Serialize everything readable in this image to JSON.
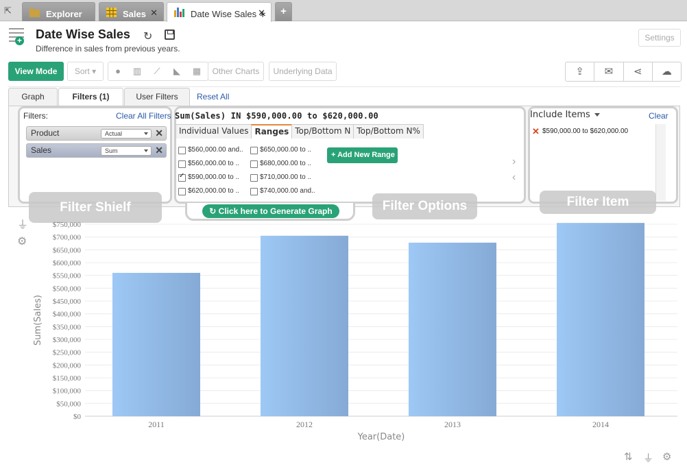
{
  "tabs": {
    "explorer": "Explorer",
    "sales": "Sales",
    "active": "Date Wise Sales ∗",
    "close": "✕",
    "new": "+"
  },
  "header": {
    "title": "Date Wise Sales",
    "subtitle": "Difference in sales from previous years.",
    "settings": "Settings"
  },
  "toolbar": {
    "view_mode": "View Mode",
    "sort": "Sort ▾",
    "other_charts": "Other Charts",
    "underlying_data": "Underlying Data",
    "chart_icons": [
      "pie-chart-icon",
      "bar-chart-icon",
      "line-chart-icon",
      "area-chart-icon",
      "table-icon"
    ],
    "actions": [
      "export-icon",
      "email-icon",
      "share-icon",
      "publish-icon"
    ]
  },
  "filter_tabs": {
    "graph": "Graph",
    "filters": "Filters  (1)",
    "user_filters": "User Filters",
    "reset_all": "Reset All"
  },
  "shelf": {
    "label": "Filters:",
    "clear_all": "Clear All Filters",
    "pills": [
      {
        "name": "Product",
        "option": "Actual"
      },
      {
        "name": "Sales",
        "option": "Sum"
      }
    ]
  },
  "options": {
    "title": "Sum(Sales) IN $590,000.00 to $620,000.00",
    "tabs": [
      "Individual Values",
      "Ranges",
      "Top/Bottom N",
      "Top/Bottom N%"
    ],
    "active_tab": "Ranges",
    "ranges_col1": [
      "$560,000.00 and..",
      "$560,000.00 to ..",
      "$590,000.00 to ..",
      "$620,000.00 to .."
    ],
    "ranges_col2": [
      "$650,000.00 to ..",
      "$680,000.00 to ..",
      "$710,000.00 to ..",
      "$740,000.00 and.."
    ],
    "checked": "$590,000.00 to ..",
    "add_range": "Add New Range"
  },
  "include": {
    "title": "Include Items",
    "clear": "Clear",
    "items": [
      "$590,000.00 to $620,000.00"
    ]
  },
  "overlays": {
    "shelf": "Filter Shielf",
    "options": "Filter Options",
    "item": "Filter Item"
  },
  "generate": "Click here to Generate Graph",
  "colors": {
    "accent": "#2aa277",
    "link": "#2a5aa8",
    "bar_light": "#9ec8f5",
    "bar_dark": "#85aad5"
  },
  "chart_data": {
    "type": "bar",
    "categories": [
      "2011",
      "2012",
      "2013",
      "2014"
    ],
    "values": [
      560000,
      705000,
      678000,
      755000
    ],
    "xlabel": "Year(Date)",
    "ylabel": "Sum(Sales)",
    "ylim": [
      0,
      750000
    ],
    "yticks": [
      "$0",
      "$50,000",
      "$100,000",
      "$150,000",
      "$200,000",
      "$250,000",
      "$300,000",
      "$350,000",
      "$400,000",
      "$450,000",
      "$500,000",
      "$550,000",
      "$600,000",
      "$650,000",
      "$700,000",
      "$750,000"
    ],
    "grid": true
  }
}
